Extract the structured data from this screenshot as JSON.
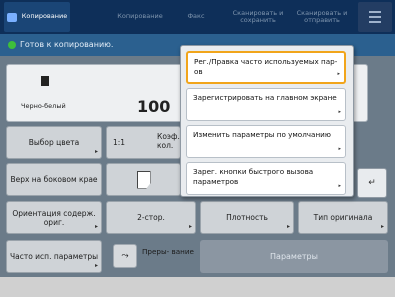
{
  "tabs": [
    {
      "label": "Копирование",
      "active": true
    },
    {
      "label": "Копирование",
      "active": false
    },
    {
      "label": "Факс",
      "active": false
    },
    {
      "label": "Сканировать и сохранить",
      "active": false
    },
    {
      "label": "Сканировать и отправить",
      "active": false
    }
  ],
  "status": {
    "text": "Готов к копированию."
  },
  "main": {
    "color_mode_label": "Черно-белый",
    "copies": "100",
    "color_select_label": "Выбор цвета",
    "ratio_label": "1:1",
    "coefficient_label": "Коэф. кол.",
    "book_mode_label": "Верх на боковом крае",
    "orientation_label": "Ориентация содерж. ориг.",
    "duplex_label": "2-стор.",
    "density_label": "Плотность",
    "original_type_label": "Тип оригинала",
    "frequent_params_label": "Часто исп. параметры",
    "interrupt_label": "Преры- вание",
    "params_label": "Параметры"
  },
  "popup": {
    "items": [
      {
        "label": "Рег./Правка часто используемых пар-ов",
        "selected": true
      },
      {
        "label": "Зарегистрировать на главном экране",
        "selected": false
      },
      {
        "label": "Изменить параметры по умолчанию",
        "selected": false
      },
      {
        "label": "Зарег. кнопки быстрого вызова параметров",
        "selected": false
      }
    ]
  },
  "icons": {
    "confirm": "return-icon",
    "menu": "menu-icon",
    "interrupt": "interrupt-icon"
  },
  "colors": {
    "accent": "#f1a51b",
    "status_ok": "#3ebf3a"
  }
}
